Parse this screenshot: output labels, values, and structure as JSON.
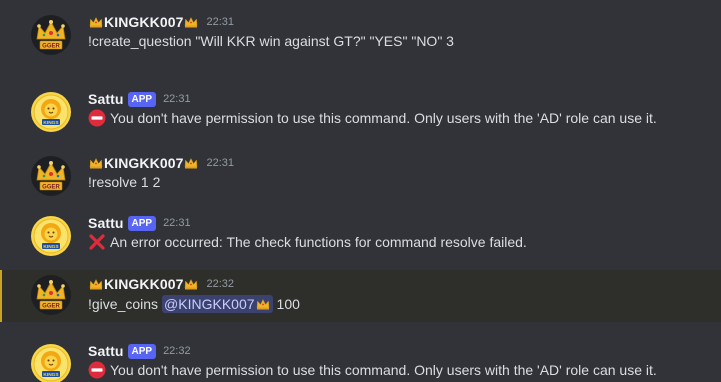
{
  "messages": [
    {
      "author": "KINGKK007",
      "author_type": "user",
      "time": "22:31",
      "text": "!create_question \"Will KKR win against GT?\" \"YES\" \"NO\" 3"
    },
    {
      "author": "Sattu",
      "author_type": "bot",
      "badge": "APP",
      "time": "22:31",
      "status_icon": "no-entry-icon",
      "text": "You don't have permission to use this command. Only users with the 'AD' role can use it."
    },
    {
      "author": "KINGKK007",
      "author_type": "user",
      "time": "22:31",
      "text": "!resolve 1 2"
    },
    {
      "author": "Sattu",
      "author_type": "bot",
      "badge": "APP",
      "time": "22:31",
      "status_icon": "red-cross-icon",
      "text": "An error occurred: The check functions for command resolve failed."
    },
    {
      "author": "KINGKK007",
      "author_type": "user",
      "time": "22:32",
      "highlighted": true,
      "text_prefix": "!give_coins",
      "mention": "@KINGKK007",
      "text_suffix": "100"
    },
    {
      "author": "Sattu",
      "author_type": "bot",
      "badge": "APP",
      "time": "22:32",
      "status_icon": "no-entry-icon",
      "text": "You don't have permission to use this command. Only users with the 'AD' role can use it."
    }
  ],
  "colors": {
    "background": "#313338",
    "highlight_background": "#2e2f2b",
    "highlight_border": "#c9a227",
    "app_badge": "#5865f2",
    "mention_background": "#3c4270",
    "timestamp": "#949ba4",
    "text": "#dbdee1",
    "username": "#f2f3f5"
  },
  "user_avatar": {
    "icon": "crown-logo-icon",
    "lettering": "GGER"
  },
  "bot_avatar": {
    "icon": "csk-lion-logo-icon",
    "lettering": "KINGS"
  }
}
